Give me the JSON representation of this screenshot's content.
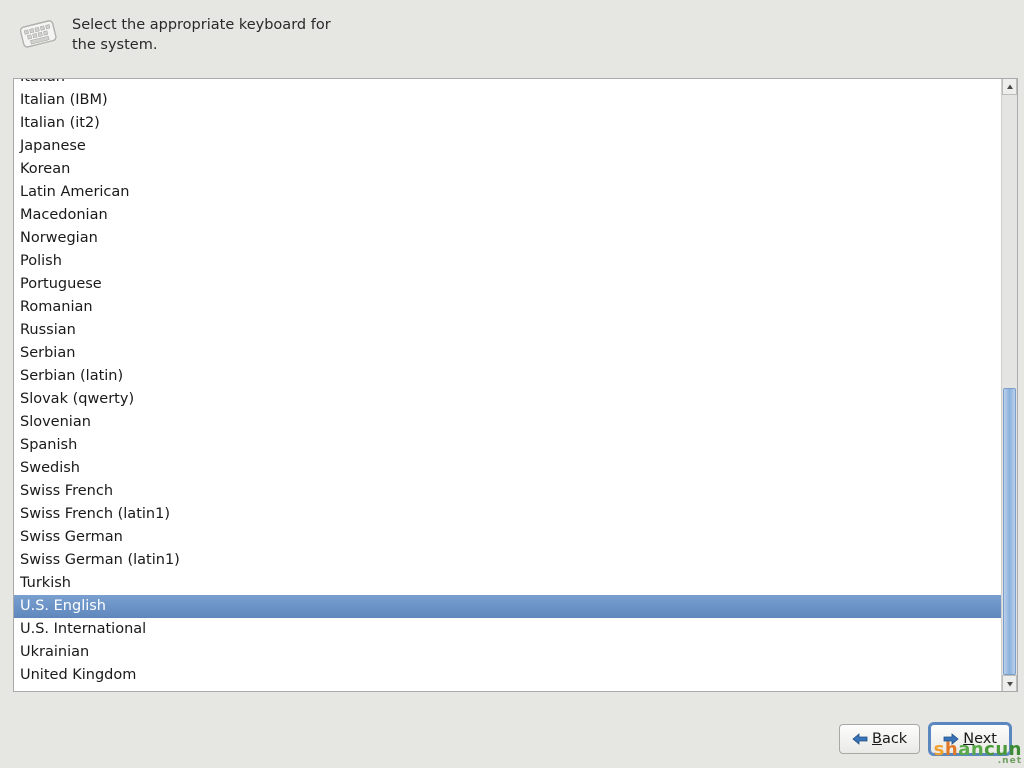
{
  "header": {
    "instruction": "Select the appropriate keyboard for the system."
  },
  "keyboard_list": {
    "selected_index": 23,
    "items": [
      "Italian",
      "Italian (IBM)",
      "Italian (it2)",
      "Japanese",
      "Korean",
      "Latin American",
      "Macedonian",
      "Norwegian",
      "Polish",
      "Portuguese",
      "Romanian",
      "Russian",
      "Serbian",
      "Serbian (latin)",
      "Slovak (qwerty)",
      "Slovenian",
      "Spanish",
      "Swedish",
      "Swiss French",
      "Swiss French (latin1)",
      "Swiss German",
      "Swiss German (latin1)",
      "Turkish",
      "U.S. English",
      "U.S. International",
      "Ukrainian",
      "United Kingdom"
    ]
  },
  "scrollbar": {
    "thumb_top_pct": 50.5,
    "thumb_height_pct": 49.5
  },
  "footer": {
    "back_label": "Back",
    "next_label": "Next"
  },
  "watermark": {
    "text": "shancun",
    "sub": ".net"
  }
}
